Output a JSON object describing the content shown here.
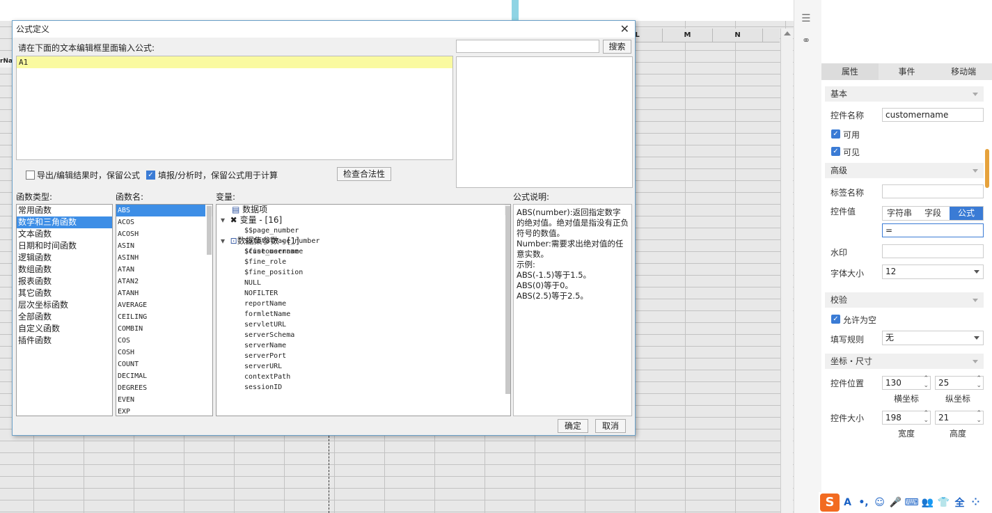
{
  "sheet": {
    "columns": [
      "L",
      "M",
      "N"
    ],
    "cell_fragment": "rNa"
  },
  "panel": {
    "tabs": [
      "属性",
      "事件",
      "移动端"
    ],
    "sections": {
      "basic": "基本",
      "advanced": "高级",
      "validate": "校验",
      "coord": "坐标・尺寸"
    },
    "widget_name_label": "控件名称",
    "widget_name": "customername",
    "enabled": "可用",
    "visible": "可见",
    "tag_label": "标签名称",
    "tag_value": "",
    "value_label": "控件值",
    "value_modes": [
      "字符串",
      "字段",
      "公式"
    ],
    "value_mode_selected": "公式",
    "value_formula": "=",
    "watermark_label": "水印",
    "watermark": "",
    "font_size_label": "字体大小",
    "font_size": "12",
    "allow_empty": "允许为空",
    "rule_label": "填写规则",
    "rule": "无",
    "pos_label": "控件位置",
    "pos_x": "130",
    "pos_y": "25",
    "pos_x_label": "横坐标",
    "pos_y_label": "纵坐标",
    "size_label": "控件大小",
    "width": "198",
    "height": "21",
    "width_label": "宽度",
    "height_label": "高度"
  },
  "ime": {
    "logo": "S",
    "icons": [
      "A",
      "•,",
      "☺",
      "🎤",
      "⌨",
      "👥",
      "👕",
      "全",
      "⁘"
    ]
  },
  "dialog": {
    "title": "公式定义",
    "prompt": "请在下面的文本编辑框里面输入公式:",
    "formula": "A1",
    "search_value": "",
    "search_button": "搜索",
    "keep_formula_export": "导出/编辑结果时，保留公式",
    "keep_formula_fill": "填报/分析时，保留公式用于计算",
    "check_button": "检查合法性",
    "func_type_label": "函数类型:",
    "func_types": [
      "常用函数",
      "数学和三角函数",
      "文本函数",
      "日期和时间函数",
      "逻辑函数",
      "数组函数",
      "报表函数",
      "其它函数",
      "层次坐标函数",
      "全部函数",
      "自定义函数",
      "插件函数"
    ],
    "func_type_selected": 1,
    "func_name_label": "函数名:",
    "func_names": [
      "ABS",
      "ACOS",
      "ACOSH",
      "ASIN",
      "ASINH",
      "ATAN",
      "ATAN2",
      "ATANH",
      "AVERAGE",
      "CEILING",
      "COMBIN",
      "COS",
      "COSH",
      "COUNT",
      "DECIMAL",
      "DEGREES",
      "EVEN",
      "EXP"
    ],
    "var_label": "变量:",
    "var_root": "数据项",
    "var_group": "变量 - [16]",
    "variables": [
      "$$page_number",
      "$$totalPage_number",
      "$fine_username",
      "$fine_role",
      "$fine_position",
      "NULL",
      "NOFILTER",
      "reportName",
      "formletName",
      "servletURL",
      "serverSchema",
      "serverName",
      "serverPort",
      "serverURL",
      "contextPath",
      "sessionID"
    ],
    "param_group": "数据集参数 - [1]",
    "params": [
      "$customername"
    ],
    "desc_label": "公式说明:",
    "description": [
      "ABS(number):返回指定数字的绝对值。绝对值是指没有正负符号的数值。",
      "Number:需要求出绝对值的任意实数。",
      "示例:",
      "ABS(-1.5)等于1.5。",
      "ABS(0)等于0。",
      "ABS(2.5)等于2.5。"
    ],
    "ok": "确定",
    "cancel": "取消"
  }
}
